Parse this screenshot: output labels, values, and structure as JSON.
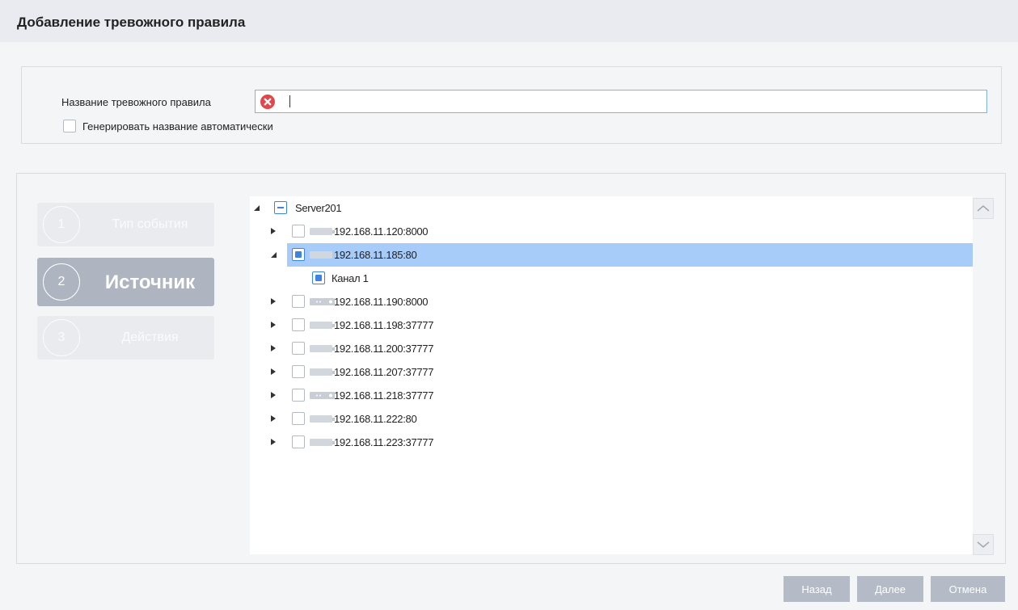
{
  "header": {
    "title": "Добавление тревожного правила"
  },
  "form": {
    "name_label": "Название тревожного правила",
    "name_value": "",
    "auto_label": "Генерировать название автоматически",
    "auto_checked": false
  },
  "steps": [
    {
      "number": "1",
      "label": "Тип события",
      "state": "inactive"
    },
    {
      "number": "2",
      "label": "Источник",
      "state": "active"
    },
    {
      "number": "3",
      "label": "Действия",
      "state": "inactive"
    }
  ],
  "tree": {
    "root": {
      "label": "Server201",
      "expanded": true,
      "check": "partial"
    },
    "devices": [
      {
        "label": "192.168.11.120:8000",
        "icon": "camera-device-icon",
        "expanded": false,
        "check": "none"
      },
      {
        "label": "192.168.11.185:80",
        "icon": "camera-device-icon",
        "expanded": true,
        "check": "partial",
        "selected": true,
        "children": [
          {
            "label": "Канал 1",
            "check": "checked"
          }
        ]
      },
      {
        "label": "192.168.11.190:8000",
        "icon": "recorder-device-icon",
        "expanded": false,
        "check": "none"
      },
      {
        "label": "192.168.11.198:37777",
        "icon": "camera-device-icon",
        "expanded": false,
        "check": "none"
      },
      {
        "label": "192.168.11.200:37777",
        "icon": "camera-device-icon",
        "expanded": false,
        "check": "none"
      },
      {
        "label": "192.168.11.207:37777",
        "icon": "camera-device-icon",
        "expanded": false,
        "check": "none"
      },
      {
        "label": "192.168.11.218:37777",
        "icon": "recorder-device-icon",
        "expanded": false,
        "check": "none"
      },
      {
        "label": "192.168.11.222:80",
        "icon": "camera-device-icon",
        "expanded": false,
        "check": "none"
      },
      {
        "label": "192.168.11.223:37777",
        "icon": "camera-device-icon",
        "expanded": false,
        "check": "none"
      }
    ]
  },
  "footer": {
    "back_label": "Назад",
    "next_label": "Далее",
    "cancel_label": "Отмена"
  },
  "colors": {
    "accent": "#3f83e0",
    "selected_row": "#a8ccfa",
    "error": "#e0464a",
    "button": "#b4bac6"
  }
}
